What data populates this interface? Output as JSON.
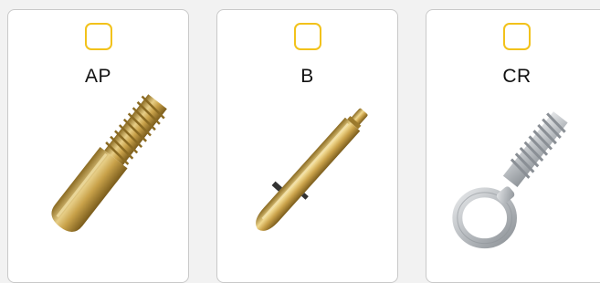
{
  "options": [
    {
      "label": "AP",
      "image": "threaded-brass-pin-icon",
      "checked": false
    },
    {
      "label": "B",
      "image": "brass-pin-with-side-knob-icon",
      "checked": false
    },
    {
      "label": "CR",
      "image": "eye-bolt-icon",
      "checked": false
    }
  ],
  "colors": {
    "checkbox_border": "#f2c21b",
    "card_border": "#c9c9c9",
    "background": "#f2f2f2",
    "brass": "#c9a24a",
    "steel": "#b8bcc0"
  }
}
